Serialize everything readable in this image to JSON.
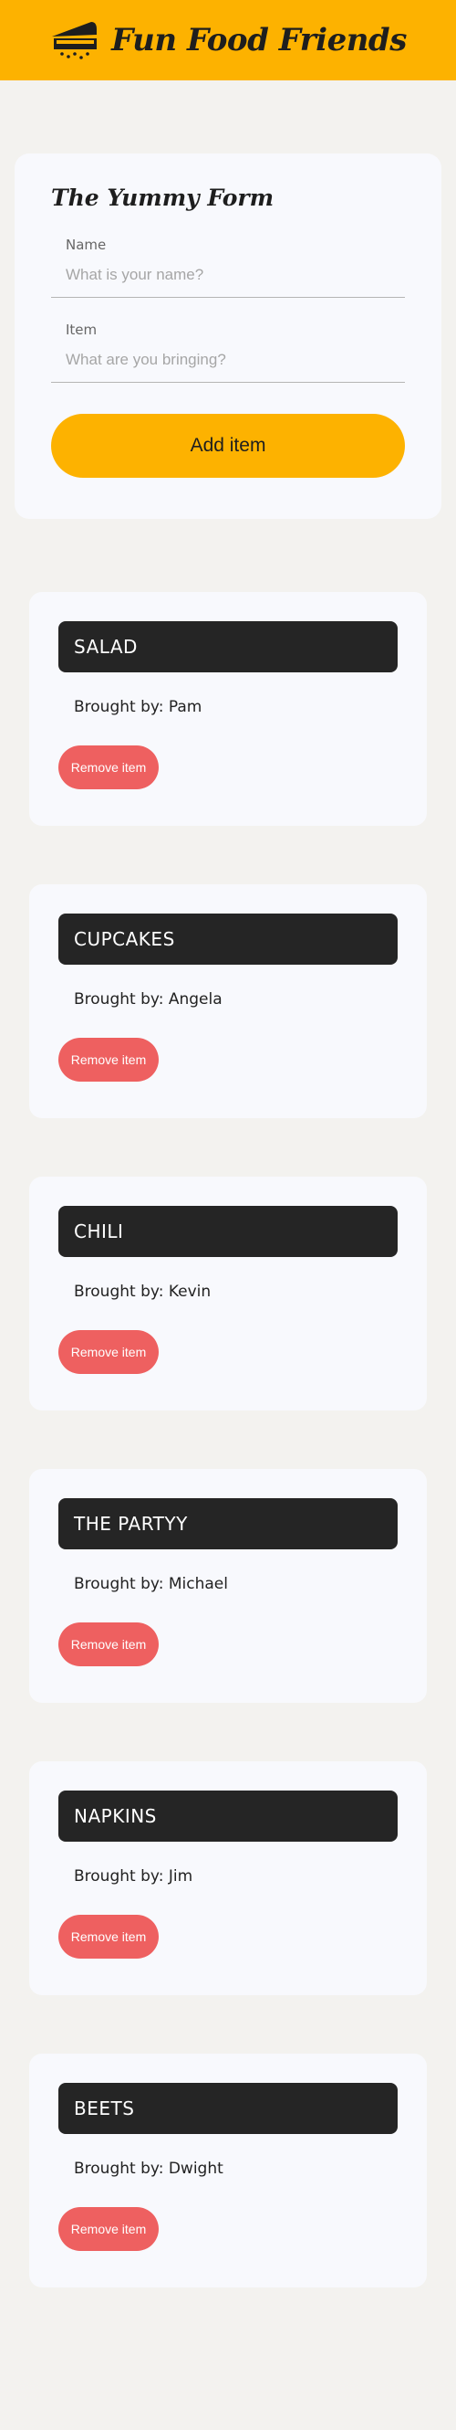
{
  "header": {
    "title": "Fun Food Friends",
    "icon": "pie-icon",
    "background_color": "#fdb200"
  },
  "form": {
    "title": "The Yummy Form",
    "name_label": "Name",
    "name_placeholder": "What is your name?",
    "name_value": "",
    "item_label": "Item",
    "item_placeholder": "What are you bringing?",
    "item_value": "",
    "submit_label": "Add item"
  },
  "items": [
    {
      "name": "SALAD",
      "brought_by": "Brought by: Pam",
      "remove_label": "Remove item"
    },
    {
      "name": "CUPCAKES",
      "brought_by": "Brought by: Angela",
      "remove_label": "Remove item"
    },
    {
      "name": "CHILI",
      "brought_by": "Brought by: Kevin",
      "remove_label": "Remove item"
    },
    {
      "name": "THE PARTYY",
      "brought_by": "Brought by: Michael",
      "remove_label": "Remove item"
    },
    {
      "name": "NAPKINS",
      "brought_by": "Brought by: Jim",
      "remove_label": "Remove item"
    },
    {
      "name": "BEETS",
      "brought_by": "Brought by: Dwight",
      "remove_label": "Remove item"
    }
  ],
  "colors": {
    "accent": "#fdb200",
    "remove": "#ee6060",
    "item_header": "#252525",
    "card": "#f8f9fd",
    "page": "#f3f2ef"
  }
}
